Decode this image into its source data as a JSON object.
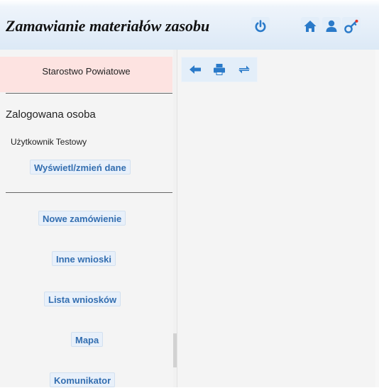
{
  "header": {
    "title": "Zamawianie materiałów zasobu",
    "colors": {
      "accent": "#2a7ac9"
    },
    "icons": [
      "power-icon",
      "home-icon",
      "user-icon",
      "key-icon"
    ]
  },
  "sidebar": {
    "organization": "Starostwo Powiatowe",
    "logged_heading": "Zalogowana osoba",
    "user_name": "Użytkownik Testowy",
    "edit_label": "Wyświetl/zmień dane",
    "nav": {
      "new_order": "Nowe zamówienie",
      "other_requests": "Inne wnioski",
      "request_list": "Lista wniosków",
      "map": "Mapa",
      "messenger": "Komunikator"
    }
  },
  "toolbar": {
    "icons": [
      "back-arrow-icon",
      "print-icon",
      "refresh-icon"
    ]
  }
}
